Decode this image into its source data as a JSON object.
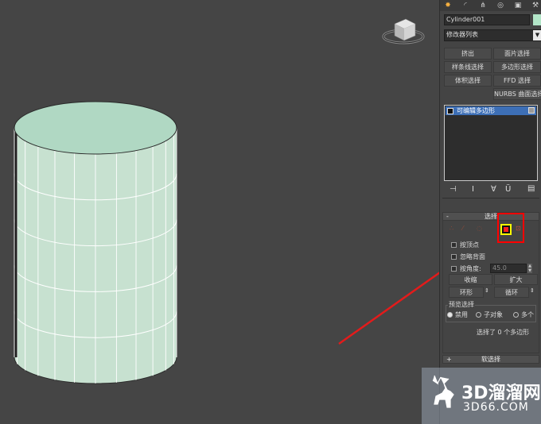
{
  "panel": {
    "object_name": "Cylinder001",
    "modifier_list": "修改器列表",
    "buttons": [
      "挤出",
      "面片选择",
      "样条线选择",
      "多边形选择",
      "体积选择",
      "FFD 选择",
      "NURBS 曲面选择"
    ],
    "stack_item": "可编辑多边形",
    "selection_rollout": {
      "title": "选择",
      "collapse_sign": "-",
      "by_vertex": "按顶点",
      "ignore_backfacing": "忽略背面",
      "by_angle": "按角度:",
      "angle_value": "45.0",
      "shrink": "收缩",
      "grow": "扩大",
      "ring": "环形",
      "loop": "循环",
      "preview_title": "预览选择",
      "preview_options": [
        "禁用",
        "子对象",
        "多个"
      ],
      "status": "选择了 0 个多边形"
    },
    "soft_selection": {
      "title": "软选择",
      "expand_sign": "+"
    }
  },
  "colors": {
    "viewport_bg": "#454545",
    "cylinder_side": "#c7e1d0",
    "cylinder_top": "#b0d8c3",
    "highlight": "#ff0000",
    "polygon_icon": "#ffff00",
    "stack_selected": "#3d6fb6"
  },
  "watermark": {
    "brand": "3D溜溜网",
    "domain": "3D66.COM"
  }
}
